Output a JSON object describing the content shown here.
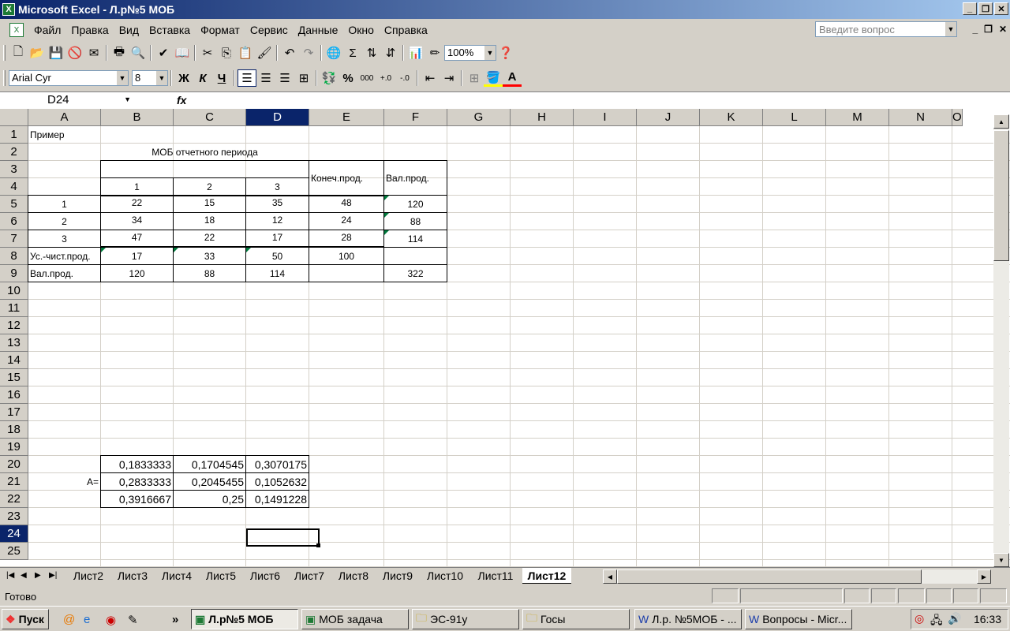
{
  "window": {
    "title": "Microsoft Excel - Л.р№5 МОБ"
  },
  "menu": {
    "items": [
      "Файл",
      "Правка",
      "Вид",
      "Вставка",
      "Формат",
      "Сервис",
      "Данные",
      "Окно",
      "Справка"
    ],
    "help_placeholder": "Введите вопрос"
  },
  "toolbar": {
    "zoom": "100%",
    "font_name": "Arial Cyr",
    "font_size": "8",
    "bold": "Ж",
    "italic": "К",
    "underline": "Ч",
    "percent": "%",
    "thousands": "000",
    "sigma": "Σ"
  },
  "formula_bar": {
    "name_box": "D24",
    "fx": "fx",
    "formula": ""
  },
  "columns": [
    "A",
    "B",
    "C",
    "D",
    "E",
    "F",
    "G",
    "H",
    "I",
    "J",
    "K",
    "L",
    "M",
    "N",
    "O"
  ],
  "rows": [
    "1",
    "2",
    "3",
    "4",
    "5",
    "6",
    "7",
    "8",
    "9",
    "10",
    "11",
    "12",
    "13",
    "14",
    "15",
    "16",
    "17",
    "18",
    "19",
    "20",
    "21",
    "22",
    "23",
    "24",
    "25"
  ],
  "selected_cell": {
    "column": "D",
    "row": "24"
  },
  "cells": {
    "A1": "Пример",
    "B2": "МОБ отчетного периода",
    "B4": "1",
    "C4": "2",
    "D4": "3",
    "E3": "Конеч.прод.",
    "F3": "Вал.прод.",
    "A5": "1",
    "B5": "22",
    "C5": "15",
    "D5": "35",
    "E5": "48",
    "F5": "120",
    "A6": "2",
    "B6": "34",
    "C6": "18",
    "D6": "12",
    "E6": "24",
    "F6": "88",
    "A7": "3",
    "B7": "47",
    "C7": "22",
    "D7": "17",
    "E7": "28",
    "F7": "114",
    "A8": "Ус.-чист.прод.",
    "B8": "17",
    "C8": "33",
    "D8": "50",
    "E8": "100",
    "A9": "Вал.прод.",
    "B9": "120",
    "C9": "88",
    "D9": "114",
    "F9": "322",
    "B20": "0,1833333",
    "C20": "0,1704545",
    "D20": "0,3070175",
    "A21": "A=",
    "B21": "0,2833333",
    "C21": "0,2045455",
    "D21": "0,1052632",
    "B22": "0,3916667",
    "C22": "0,25",
    "D22": "0,1491228"
  },
  "sheet_tabs": [
    "Лист2",
    "Лист3",
    "Лист4",
    "Лист5",
    "Лист6",
    "Лист7",
    "Лист8",
    "Лист9",
    "Лист10",
    "Лист11",
    "Лист12"
  ],
  "active_tab": "Лист12",
  "status": {
    "text": "Готово"
  },
  "taskbar": {
    "start": "Пуск",
    "buttons": [
      "Л.р№5 МОБ",
      "МОБ задача",
      "ЭС-91у",
      "Госы",
      "Л.р. №5МОБ - ...",
      "Вопросы - Micr..."
    ],
    "active_button": "Л.р№5 МОБ",
    "clock": "16:33"
  }
}
